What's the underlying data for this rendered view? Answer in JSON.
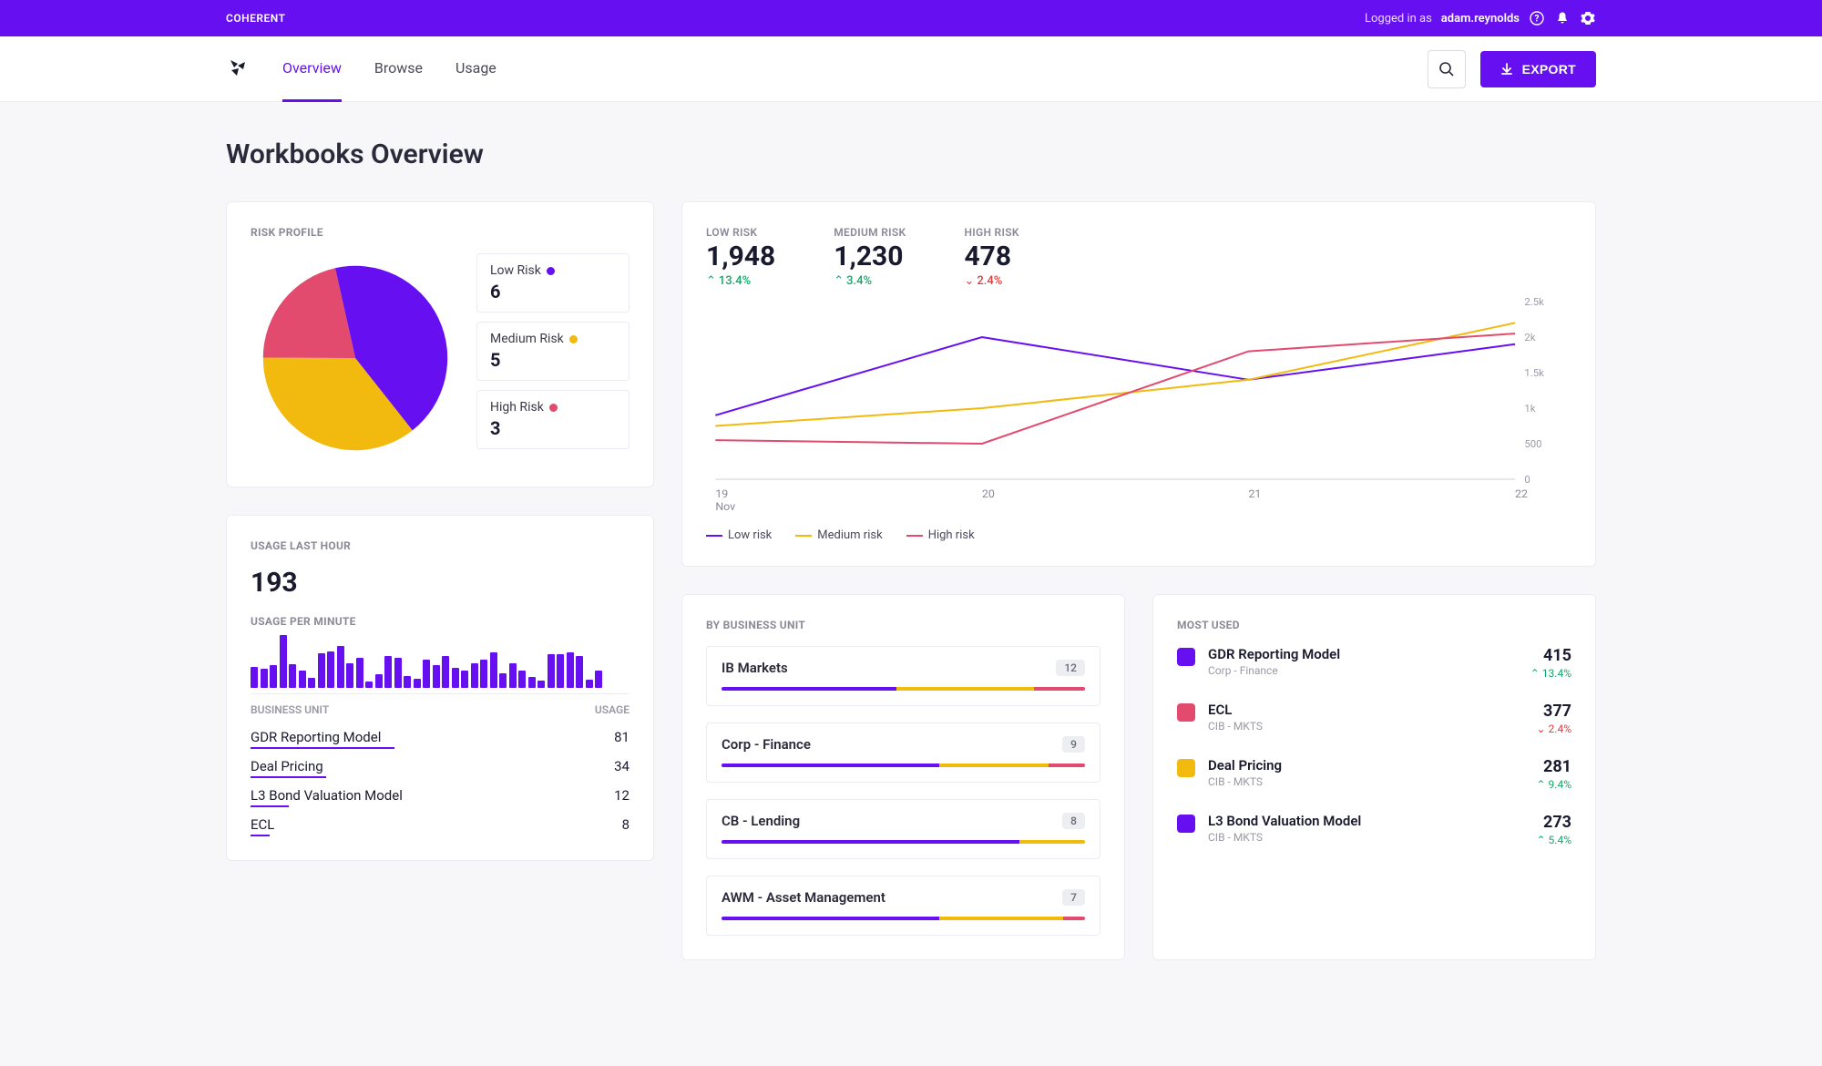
{
  "colors": {
    "purple": "#6610f2",
    "amber": "#f2b90e",
    "red": "#e24a6e",
    "green": "#10a96a",
    "redDown": "#e23c3c"
  },
  "topbar": {
    "brand": "COHERENT",
    "logged_prefix": "Logged in as",
    "username": "adam.reynolds"
  },
  "nav": {
    "tabs": [
      "Overview",
      "Browse",
      "Usage"
    ],
    "active": 0,
    "export_label": "EXPORT"
  },
  "page": {
    "title": "Workbooks Overview"
  },
  "risk_profile": {
    "title": "RISK PROFILE",
    "legend": [
      {
        "label": "Low Risk",
        "value": 6,
        "color": "#6610f2"
      },
      {
        "label": "Medium Risk",
        "value": 5,
        "color": "#f2b90e"
      },
      {
        "label": "High Risk",
        "value": 3,
        "color": "#e24a6e"
      }
    ]
  },
  "usage_card": {
    "title": "USAGE LAST HOUR",
    "value": "193",
    "sub_title": "USAGE PER MINUTE",
    "table_head": [
      "BUSINESS UNIT",
      "USAGE"
    ],
    "bars": [
      18,
      16,
      20,
      52,
      21,
      14,
      7,
      33,
      35,
      40,
      22,
      28,
      3,
      11,
      30,
      28,
      9,
      6,
      26,
      20,
      30,
      17,
      14,
      22,
      26,
      34,
      12,
      22,
      14,
      8,
      4,
      32,
      32,
      34,
      30,
      5,
      14
    ],
    "rows": [
      {
        "name": "GDR Reporting Model",
        "value": 81,
        "barPct": 38
      },
      {
        "name": "Deal Pricing",
        "value": 34,
        "barPct": 20
      },
      {
        "name": "L3 Bond Valuation Model",
        "value": 12,
        "barPct": 10
      },
      {
        "name": "ECL",
        "value": 8,
        "barPct": 5
      }
    ]
  },
  "trend": {
    "stats": [
      {
        "label": "LOW RISK",
        "value": "1,948",
        "delta": "13.4%",
        "dir": "up"
      },
      {
        "label": "MEDIUM RISK",
        "value": "1,230",
        "delta": "3.4%",
        "dir": "up"
      },
      {
        "label": "HIGH RISK",
        "value": "478",
        "delta": "2.4%",
        "dir": "down"
      }
    ],
    "legend": [
      {
        "label": "Low risk",
        "color": "#6610f2"
      },
      {
        "label": "Medium risk",
        "color": "#f2b90e"
      },
      {
        "label": "High risk",
        "color": "#e24a6e"
      }
    ],
    "x_ticks": [
      "19",
      "20",
      "21",
      "22"
    ],
    "x_sub": "Nov",
    "y_ticks": [
      "0",
      "500",
      "1k",
      "1.5k",
      "2k",
      "2.5k"
    ]
  },
  "by_bu": {
    "title": "BY BUSINESS UNIT",
    "items": [
      {
        "name": "IB Markets",
        "count": 12,
        "segs": [
          48,
          38,
          14
        ]
      },
      {
        "name": "Corp - Finance",
        "count": 9,
        "segs": [
          60,
          30,
          10
        ]
      },
      {
        "name": "CB - Lending",
        "count": 8,
        "segs": [
          82,
          18,
          0
        ]
      },
      {
        "name": "AWM - Asset Management",
        "count": 7,
        "segs": [
          60,
          34,
          6
        ]
      }
    ]
  },
  "most_used": {
    "title": "MOST USED",
    "items": [
      {
        "name": "GDR Reporting Model",
        "sub": "Corp - Finance",
        "value": 415,
        "delta": "13.4%",
        "dir": "up",
        "color": "#6610f2"
      },
      {
        "name": "ECL",
        "sub": "CIB - MKTS",
        "value": 377,
        "delta": "2.4%",
        "dir": "down",
        "color": "#e24a6e"
      },
      {
        "name": "Deal Pricing",
        "sub": "CIB - MKTS",
        "value": 281,
        "delta": "9.4%",
        "dir": "up",
        "color": "#f2b90e"
      },
      {
        "name": "L3 Bond Valuation Model",
        "sub": "CIB - MKTS",
        "value": 273,
        "delta": "5.4%",
        "dir": "up",
        "color": "#6610f2"
      }
    ]
  },
  "chart_data": [
    {
      "type": "pie",
      "title": "Risk Profile",
      "series": [
        {
          "name": "Low Risk",
          "value": 6
        },
        {
          "name": "Medium Risk",
          "value": 5
        },
        {
          "name": "High Risk",
          "value": 3
        }
      ]
    },
    {
      "type": "bar",
      "title": "Usage per minute",
      "categories": [],
      "values": [
        18,
        16,
        20,
        52,
        21,
        14,
        7,
        33,
        35,
        40,
        22,
        28,
        3,
        11,
        30,
        28,
        9,
        6,
        26,
        20,
        30,
        17,
        14,
        22,
        26,
        34,
        12,
        22,
        14,
        8,
        4,
        32,
        32,
        34,
        30,
        5,
        14
      ],
      "ylim": [
        0,
        60
      ]
    },
    {
      "type": "line",
      "title": "Risk trend",
      "x": [
        19,
        20,
        21,
        22
      ],
      "xlabel": "Nov",
      "ylim": [
        0,
        2500
      ],
      "series": [
        {
          "name": "Low risk",
          "values": [
            900,
            2000,
            1400,
            1900
          ]
        },
        {
          "name": "Medium risk",
          "values": [
            750,
            1000,
            1400,
            2200
          ]
        },
        {
          "name": "High risk",
          "values": [
            550,
            500,
            1800,
            2050
          ]
        }
      ]
    }
  ]
}
